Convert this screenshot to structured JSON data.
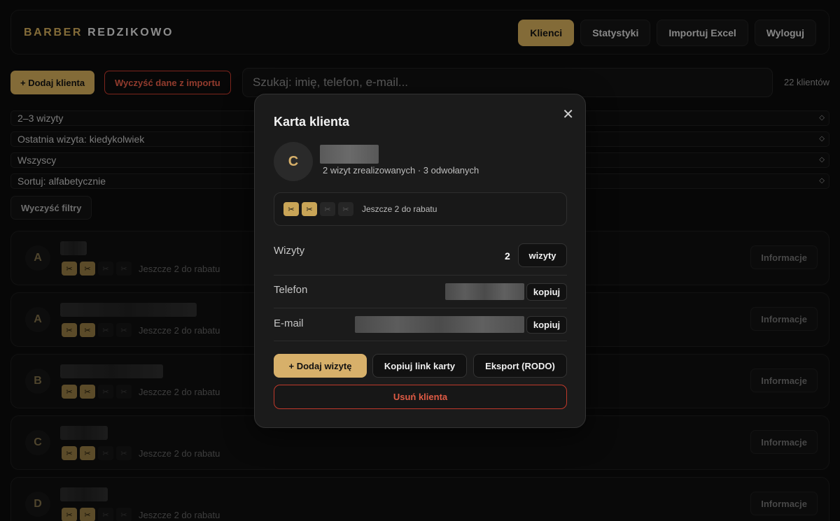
{
  "brand": {
    "part1": "BARBER",
    "part2": "REDZIKOWO"
  },
  "nav": [
    {
      "label": "Klienci",
      "active": true
    },
    {
      "label": "Statystyki",
      "active": false
    },
    {
      "label": "Importuj Excel",
      "active": false
    },
    {
      "label": "Wyloguj",
      "active": false
    }
  ],
  "toolbar": {
    "add_label": "+ Dodaj klienta",
    "clear_import_label": "Wyczyść dane z importu",
    "search_placeholder": "Szukaj: imię, telefon, e-mail...",
    "count_text": "22 klientów"
  },
  "filters": [
    {
      "value": "2–3 wizyty"
    },
    {
      "value": "Ostatnia wizyta: kiedykolwiek"
    },
    {
      "value": "Wszyscy"
    },
    {
      "value": "Sortuj: alfabetycznie"
    }
  ],
  "clear_filters_label": "Wyczyść filtry",
  "clients": [
    {
      "initial": "A",
      "stamps_filled": 2,
      "stamps_total": 4,
      "reward_text": "Jeszcze 2 do rabatu",
      "info_label": "Informacje"
    },
    {
      "initial": "A",
      "stamps_filled": 2,
      "stamps_total": 4,
      "reward_text": "Jeszcze 2 do rabatu",
      "info_label": "Informacje"
    },
    {
      "initial": "B",
      "stamps_filled": 2,
      "stamps_total": 4,
      "reward_text": "Jeszcze 2 do rabatu",
      "info_label": "Informacje"
    },
    {
      "initial": "C",
      "stamps_filled": 2,
      "stamps_total": 4,
      "reward_text": "Jeszcze 2 do rabatu",
      "info_label": "Informacje"
    },
    {
      "initial": "D",
      "stamps_filled": 2,
      "stamps_total": 4,
      "reward_text": "Jeszcze 2 do rabatu",
      "info_label": "Informacje"
    }
  ],
  "modal": {
    "title": "Karta klienta",
    "close_symbol": "✕",
    "initial": "C",
    "summary": "2 wizyt zrealizowanych · 3 odwołanych",
    "stamps_filled": 2,
    "stamps_total": 4,
    "reward_text": "Jeszcze 2 do rabatu",
    "visits_label": "Wizyty",
    "visits_value": "2",
    "visits_button": "wizyty",
    "phone_label": "Telefon",
    "email_label": "E-mail",
    "copy_label": "kopiuj",
    "add_visit_label": "+ Dodaj wizytę",
    "copy_link_label": "Kopiuj link karty",
    "export_label": "Eksport (RODO)",
    "delete_label": "Usuń klienta"
  },
  "icons": {
    "stamp": "scissors-icon",
    "select": "chevron-updown-icon",
    "close": "close-icon"
  },
  "colors": {
    "accent": "#c9a557",
    "danger": "#e05b45",
    "background": "#0b0b0b"
  }
}
